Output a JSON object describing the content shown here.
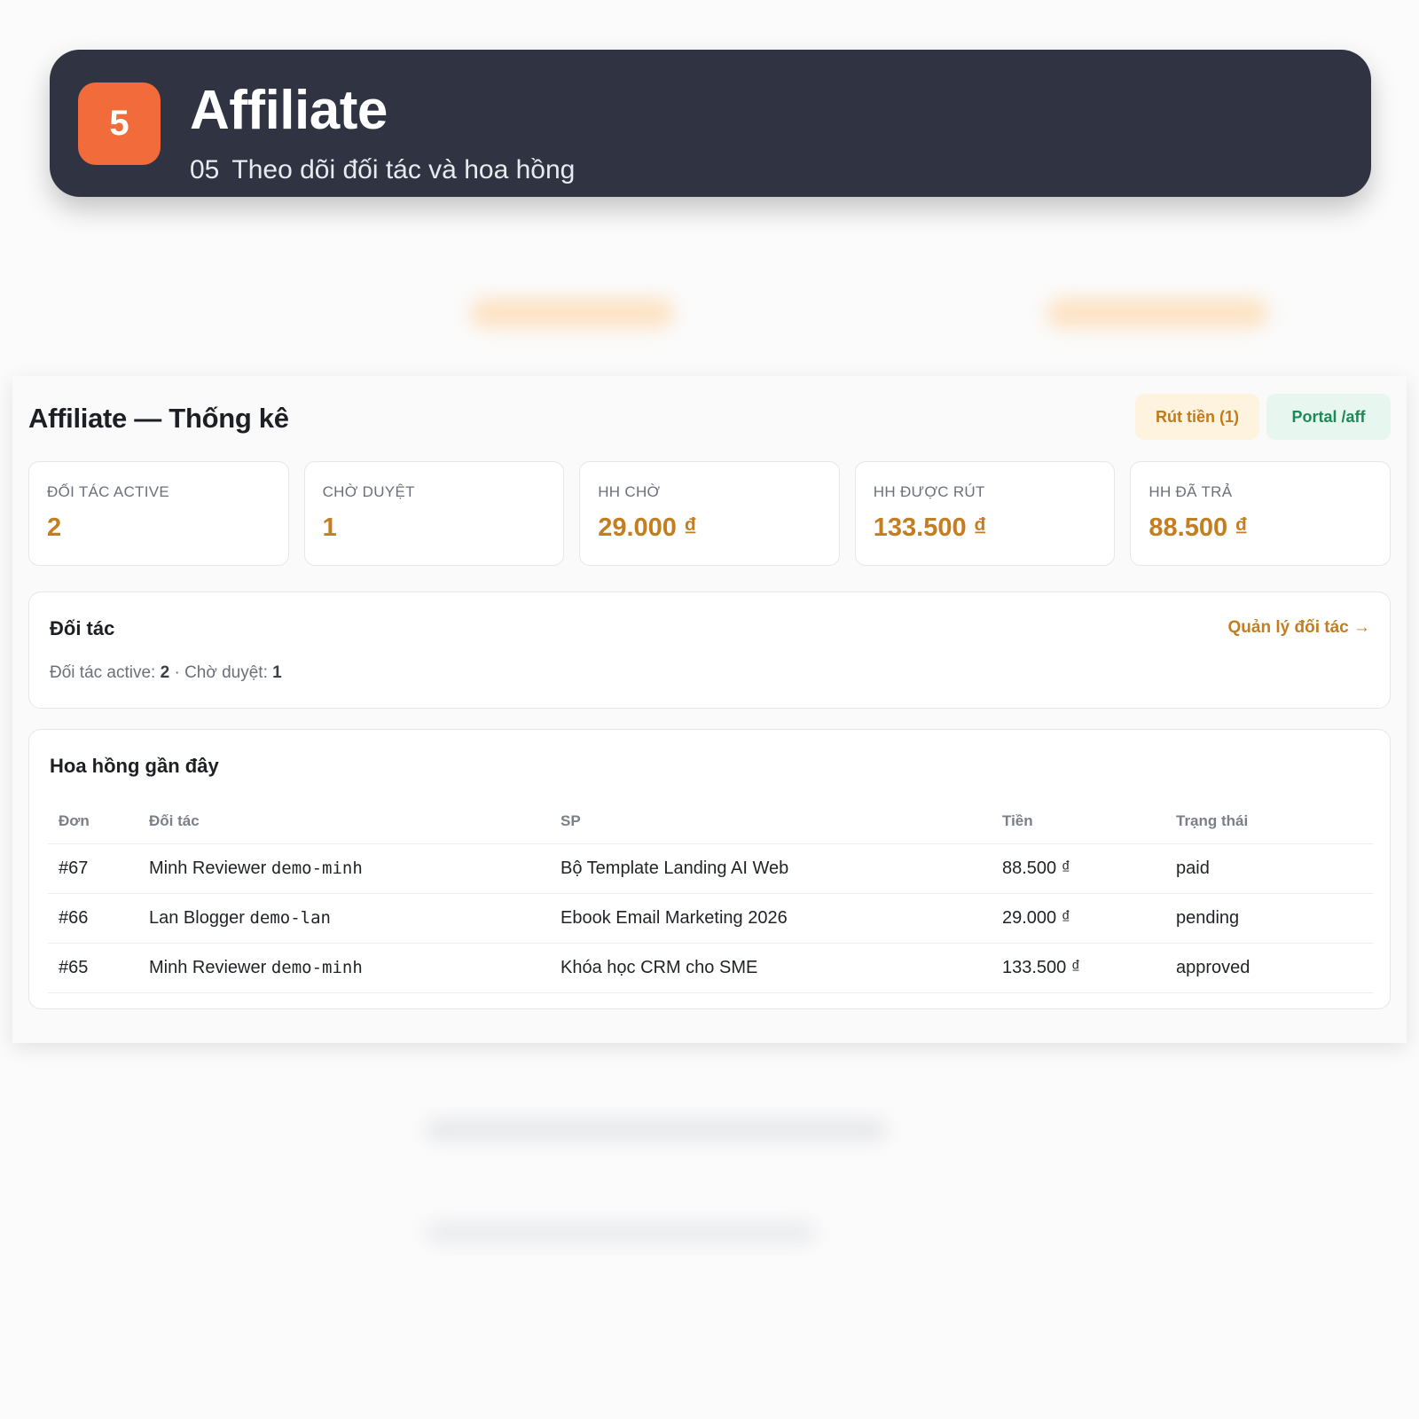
{
  "banner": {
    "step": "5",
    "title": "Affiliate",
    "subtitle_number": "05",
    "subtitle": "Theo dõi đối tác và hoa hồng"
  },
  "panel": {
    "title": "Affiliate — Thống kê",
    "buttons": {
      "withdraw": "Rút tiền (1)",
      "portal": "Portal /aff"
    },
    "stats": [
      {
        "label": "Đối tác active",
        "value": "2"
      },
      {
        "label": "Chờ duyệt",
        "value": "1"
      },
      {
        "label": "HH chờ",
        "value": "29.000 ₫"
      },
      {
        "label": "HH được rút",
        "value": "133.500 ₫"
      },
      {
        "label": "HH đã trả",
        "value": "88.500 ₫"
      }
    ],
    "partners": {
      "heading": "Đối tác",
      "manage_link": "Quản lý đối tác →",
      "active_label": "Đối tác active:",
      "active_count": "2",
      "separator": "·",
      "pending_label": "Chờ duyệt:",
      "pending_count": "1"
    },
    "commissions": {
      "heading": "Hoa hồng gần đây",
      "columns": [
        "Đơn",
        "Đối tác",
        "SP",
        "Tiền",
        "Trạng thái"
      ],
      "rows": [
        {
          "order": "#67",
          "partner_name": "Minh Reviewer",
          "partner_code": "demo-minh",
          "product": "Bộ Template Landing AI Web",
          "amount": "88.500 ₫",
          "status": "paid"
        },
        {
          "order": "#66",
          "partner_name": "Lan Blogger",
          "partner_code": "demo-lan",
          "product": "Ebook Email Marketing 2026",
          "amount": "29.000 ₫",
          "status": "pending"
        },
        {
          "order": "#65",
          "partner_name": "Minh Reviewer",
          "partner_code": "demo-minh",
          "product": "Khóa học CRM cho SME",
          "amount": "133.500 ₫",
          "status": "approved"
        }
      ]
    }
  },
  "colors": {
    "banner_bg": "#303442",
    "badge": "#f26b3a",
    "accent": "#c47d1f",
    "portal_green": "#1c8a57"
  }
}
